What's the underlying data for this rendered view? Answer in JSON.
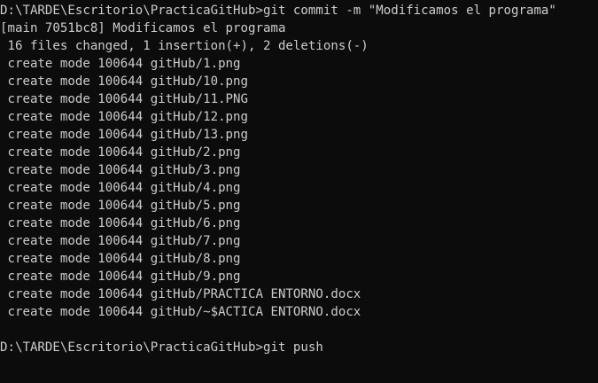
{
  "terminal": {
    "lines": [
      "D:\\TARDE\\Escritorio\\PracticaGitHub>git commit -m \"Modificamos el programa\"",
      "[main 7051bc8] Modificamos el programa",
      " 16 files changed, 1 insertion(+), 2 deletions(-)",
      " create mode 100644 gitHub/1.png",
      " create mode 100644 gitHub/10.png",
      " create mode 100644 gitHub/11.PNG",
      " create mode 100644 gitHub/12.png",
      " create mode 100644 gitHub/13.png",
      " create mode 100644 gitHub/2.png",
      " create mode 100644 gitHub/3.png",
      " create mode 100644 gitHub/4.png",
      " create mode 100644 gitHub/5.png",
      " create mode 100644 gitHub/6.png",
      " create mode 100644 gitHub/7.png",
      " create mode 100644 gitHub/8.png",
      " create mode 100644 gitHub/9.png",
      " create mode 100644 gitHub/PRACTICA ENTORNO.docx",
      " create mode 100644 gitHub/~$ACTICA ENTORNO.docx",
      "",
      "D:\\TARDE\\Escritorio\\PracticaGitHub>git push"
    ],
    "colors": {
      "background": "#0c0c0c",
      "foreground": "#cccccc"
    }
  }
}
